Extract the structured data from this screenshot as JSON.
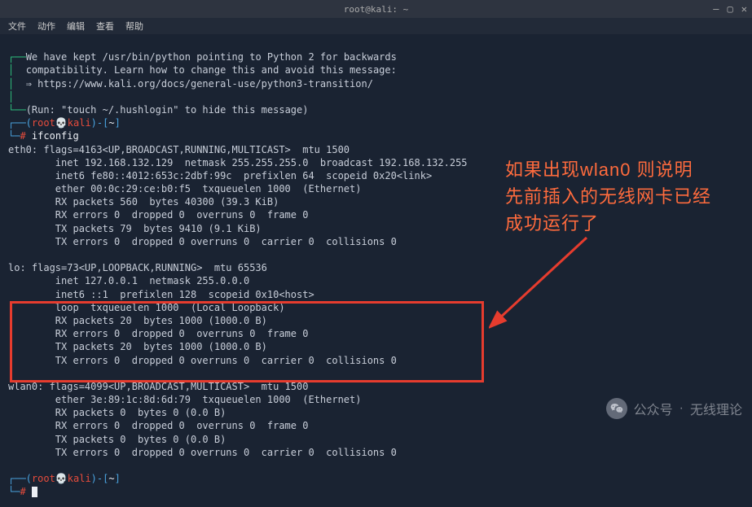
{
  "window": {
    "title": "root@kali: ~",
    "menus": [
      "文件",
      "动作",
      "编辑",
      "查看",
      "帮助"
    ],
    "controls": {
      "min": "—",
      "max": "▢",
      "close": "✕"
    }
  },
  "motd": {
    "l1": "We have kept /usr/bin/python pointing to Python 2 for backwards",
    "l2": "compatibility. Learn how to change this and avoid this message:",
    "l3": "⇒ https://www.kali.org/docs/general-use/python3-transition/",
    "l4": "(Run: \"touch ~/.hushlogin\" to hide this message)"
  },
  "prompt": {
    "user": "root",
    "host": "kali",
    "sep_open": "(",
    "sep_close": ")",
    "path": "~",
    "hash": "#",
    "cmd": "ifconfig"
  },
  "ifconfig": {
    "eth0": {
      "l1": "eth0: flags=4163<UP,BROADCAST,RUNNING,MULTICAST>  mtu 1500",
      "l2": "        inet 192.168.132.129  netmask 255.255.255.0  broadcast 192.168.132.255",
      "l3": "        inet6 fe80::4012:653c:2dbf:99c  prefixlen 64  scopeid 0x20<link>",
      "l4": "        ether 00:0c:29:ce:b0:f5  txqueuelen 1000  (Ethernet)",
      "l5": "        RX packets 560  bytes 40300 (39.3 KiB)",
      "l6": "        RX errors 0  dropped 0  overruns 0  frame 0",
      "l7": "        TX packets 79  bytes 9410 (9.1 KiB)",
      "l8": "        TX errors 0  dropped 0 overruns 0  carrier 0  collisions 0"
    },
    "lo": {
      "l1": "lo: flags=73<UP,LOOPBACK,RUNNING>  mtu 65536",
      "l2": "        inet 127.0.0.1  netmask 255.0.0.0",
      "l3": "        inet6 ::1  prefixlen 128  scopeid 0x10<host>",
      "l4": "        loop  txqueuelen 1000  (Local Loopback)",
      "l5": "        RX packets 20  bytes 1000 (1000.0 B)",
      "l6": "        RX errors 0  dropped 0  overruns 0  frame 0",
      "l7": "        TX packets 20  bytes 1000 (1000.0 B)",
      "l8": "        TX errors 0  dropped 0 overruns 0  carrier 0  collisions 0"
    },
    "wlan0": {
      "l1": "wlan0: flags=4099<UP,BROADCAST,MULTICAST>  mtu 1500",
      "l2": "        ether 3e:89:1c:8d:6d:79  txqueuelen 1000  (Ethernet)",
      "l3": "        RX packets 0  bytes 0 (0.0 B)",
      "l4": "        RX errors 0  dropped 0  overruns 0  frame 0",
      "l5": "        TX packets 0  bytes 0 (0.0 B)",
      "l6": "        TX errors 0  dropped 0 overruns 0  carrier 0  collisions 0"
    }
  },
  "annotation": {
    "l1": "如果出现wlan0 则说明",
    "l2": "先前插入的无线网卡已经",
    "l3": "成功运行了"
  },
  "watermark": {
    "label": "公众号",
    "sep": "·",
    "name": "无线理论"
  }
}
